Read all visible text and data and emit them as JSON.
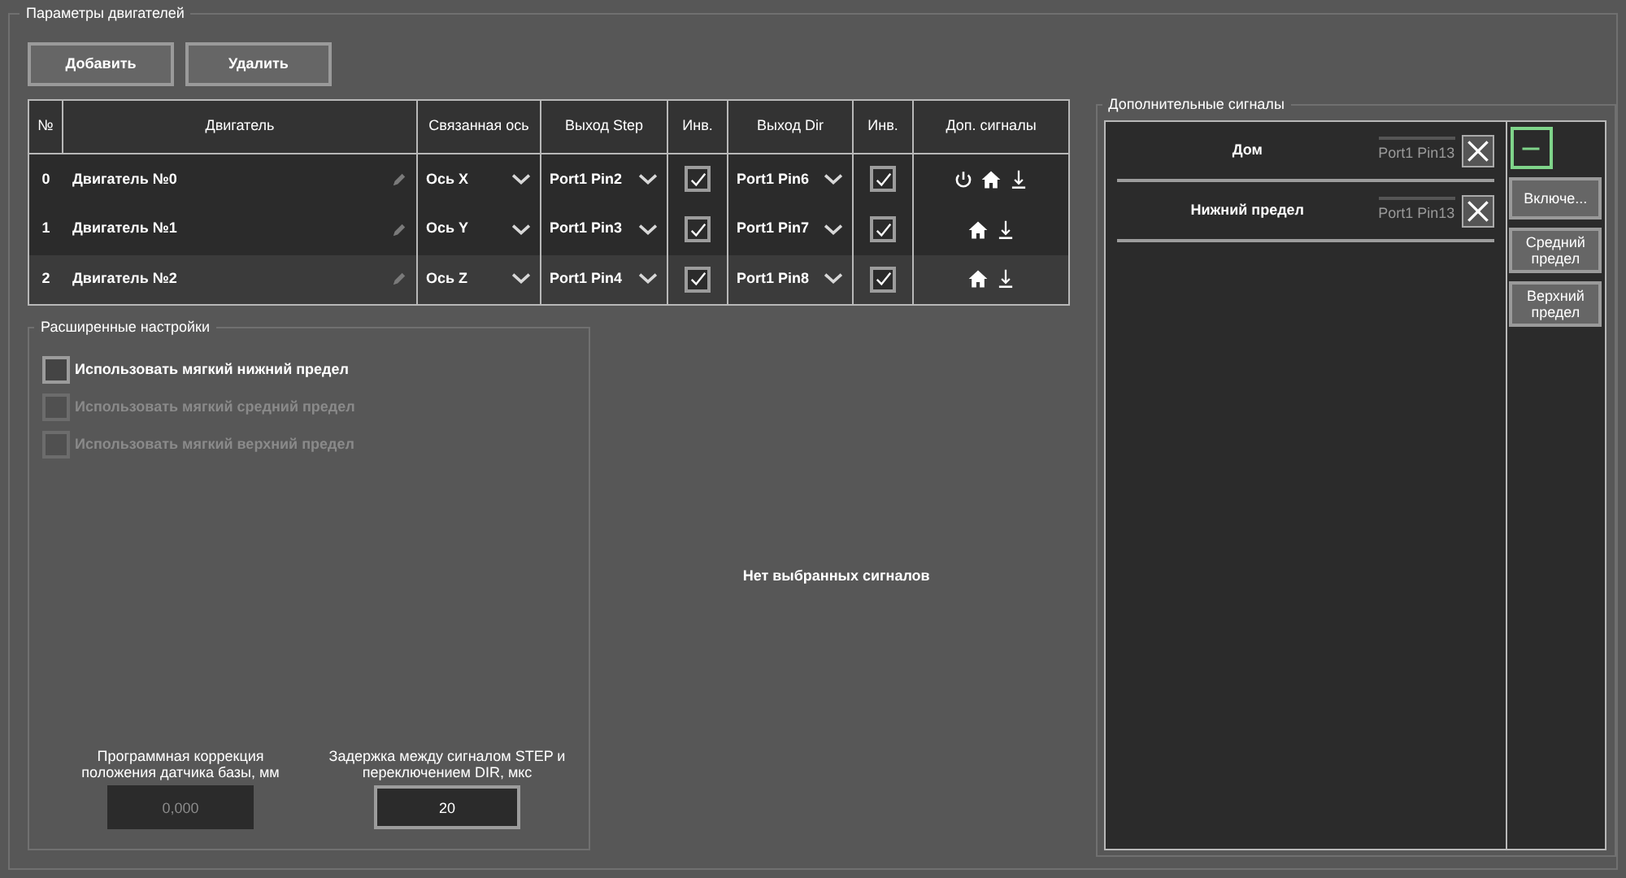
{
  "motor_params": {
    "title": "Параметры двигателей",
    "buttons": [
      "Добавить",
      "Удалить"
    ],
    "table": {
      "columns": [
        "№",
        "Двигатель",
        "Связанная ось",
        "Выход Step",
        "Инв.",
        "Выход Dir",
        "Инв.",
        "Доп. сигналы"
      ],
      "rows": [
        {
          "index": "0",
          "name": "Двигатель №0",
          "axis": "Ось X",
          "step": "Port1 Pin2",
          "step_inv": true,
          "dir": "Port1 Pin6",
          "dir_inv": true,
          "signals": [
            {
              "kind": "power"
            },
            {
              "kind": "home"
            },
            {
              "kind": "lower_limit"
            }
          ],
          "selected": false
        },
        {
          "index": "1",
          "name": "Двигатель №1",
          "axis": "Ось Y",
          "step": "Port1 Pin3",
          "step_inv": true,
          "dir": "Port1 Pin7",
          "dir_inv": true,
          "signals": [
            {
              "kind": "home"
            },
            {
              "kind": "lower_limit"
            }
          ],
          "selected": false
        },
        {
          "index": "2",
          "name": "Двигатель №2",
          "axis": "Ось Z",
          "step": "Port1 Pin4",
          "step_inv": true,
          "dir": "Port1 Pin8",
          "dir_inv": true,
          "signals": [
            {
              "kind": "home"
            },
            {
              "kind": "lower_limit"
            }
          ],
          "selected": true
        }
      ]
    },
    "advanced": {
      "title": "Расширенные настройки",
      "options": [
        {
          "label": "Использовать мягкий нижний предел",
          "checked": false,
          "disabled": false
        },
        {
          "label": "Использовать мягкий средний предел",
          "checked": false,
          "disabled": true
        },
        {
          "label": "Использовать мягкий верхний предел",
          "checked": false,
          "disabled": true
        }
      ],
      "fields": [
        {
          "label": "Программная коррекция положения датчика базы, мм",
          "value": "0,000",
          "disabled": true
        },
        {
          "label": "Задержка между сигналом STEP и переключением DIR, мкс",
          "value": "20",
          "disabled": false
        }
      ]
    },
    "empty_message": "Нет выбранных сигналов",
    "extra_signals": {
      "title": "Дополнительные сигналы",
      "items": [
        {
          "name": "Дом",
          "port": "Port1 Pin13"
        },
        {
          "name": "Нижний предел",
          "port": "Port1 Pin13"
        }
      ],
      "side_buttons": [
        {
          "kind": "remove"
        },
        {
          "kind": "text",
          "label": "Включе..."
        },
        {
          "kind": "text",
          "label": "Средний предел"
        },
        {
          "kind": "text",
          "label": "Верхний предел"
        }
      ]
    }
  }
}
